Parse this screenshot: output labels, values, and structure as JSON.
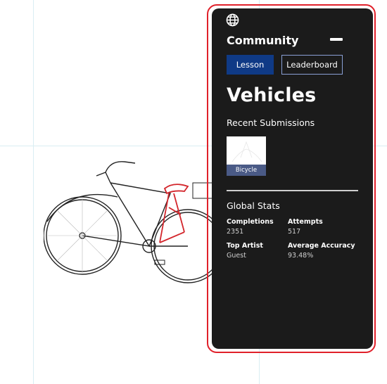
{
  "panel": {
    "title": "Community",
    "tabs": {
      "lesson": "Lesson",
      "leaderboard": "Leaderboard"
    },
    "heading": "Vehicles",
    "recent_label": "Recent Submissions",
    "submission": {
      "caption": "Bicycle"
    },
    "stats_title": "Global Stats",
    "stats": {
      "completions_label": "Completions",
      "completions_value": "2351",
      "attempts_label": "Attempts",
      "attempts_value": "517",
      "top_artist_label": "Top Artist",
      "top_artist_value": "Guest",
      "accuracy_label": "Average Accuracy",
      "accuracy_value": "93.48%"
    }
  },
  "colors": {
    "panel_bg": "#1b1b1b",
    "outline": "#e0202a",
    "lesson_tab": "#0f3a86",
    "leaderboard_border": "#8aa0d6",
    "caption_bg": "#4a5a86"
  },
  "icons": {
    "globe": "globe-icon",
    "minimize": "minimize-icon"
  }
}
